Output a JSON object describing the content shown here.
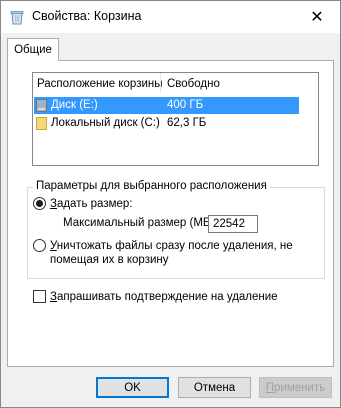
{
  "window": {
    "title": "Свойства: Корзина",
    "close_glyph": "✕"
  },
  "tabs": [
    {
      "label": "Общие"
    }
  ],
  "locations": {
    "headers": {
      "location": "Расположение корзины",
      "free": "Свободно"
    },
    "rows": [
      {
        "name": "Диск (E:)",
        "free": "400 ГБ",
        "selected": true,
        "icon": "drive-icon"
      },
      {
        "name": "Локальный диск (C:)",
        "free": "62,3 ГБ",
        "selected": false,
        "icon": "folder-drive-icon"
      }
    ]
  },
  "settings": {
    "group_title": "Параметры для выбранного расположения",
    "custom_size": {
      "label_underlined": "З",
      "label_rest": "адать размер:",
      "checked": true
    },
    "max_size": {
      "label": "Максимальный размер (МБ):",
      "value": "22542"
    },
    "delete_immediately": {
      "label_underlined": "У",
      "label_rest": "ничтожать файлы сразу после удаления, не",
      "label_line2": "помещая их в корзину",
      "checked": false
    }
  },
  "confirm_delete": {
    "label_underlined": "З",
    "label_rest": "апрашивать подтверждение на удаление",
    "checked": false
  },
  "buttons": {
    "ok": "OK",
    "cancel": "Отмена",
    "apply_underlined": "П",
    "apply_rest": "рименить",
    "apply_disabled": true
  },
  "colors": {
    "selection": "#3399ff",
    "accent": "#0078d7"
  }
}
